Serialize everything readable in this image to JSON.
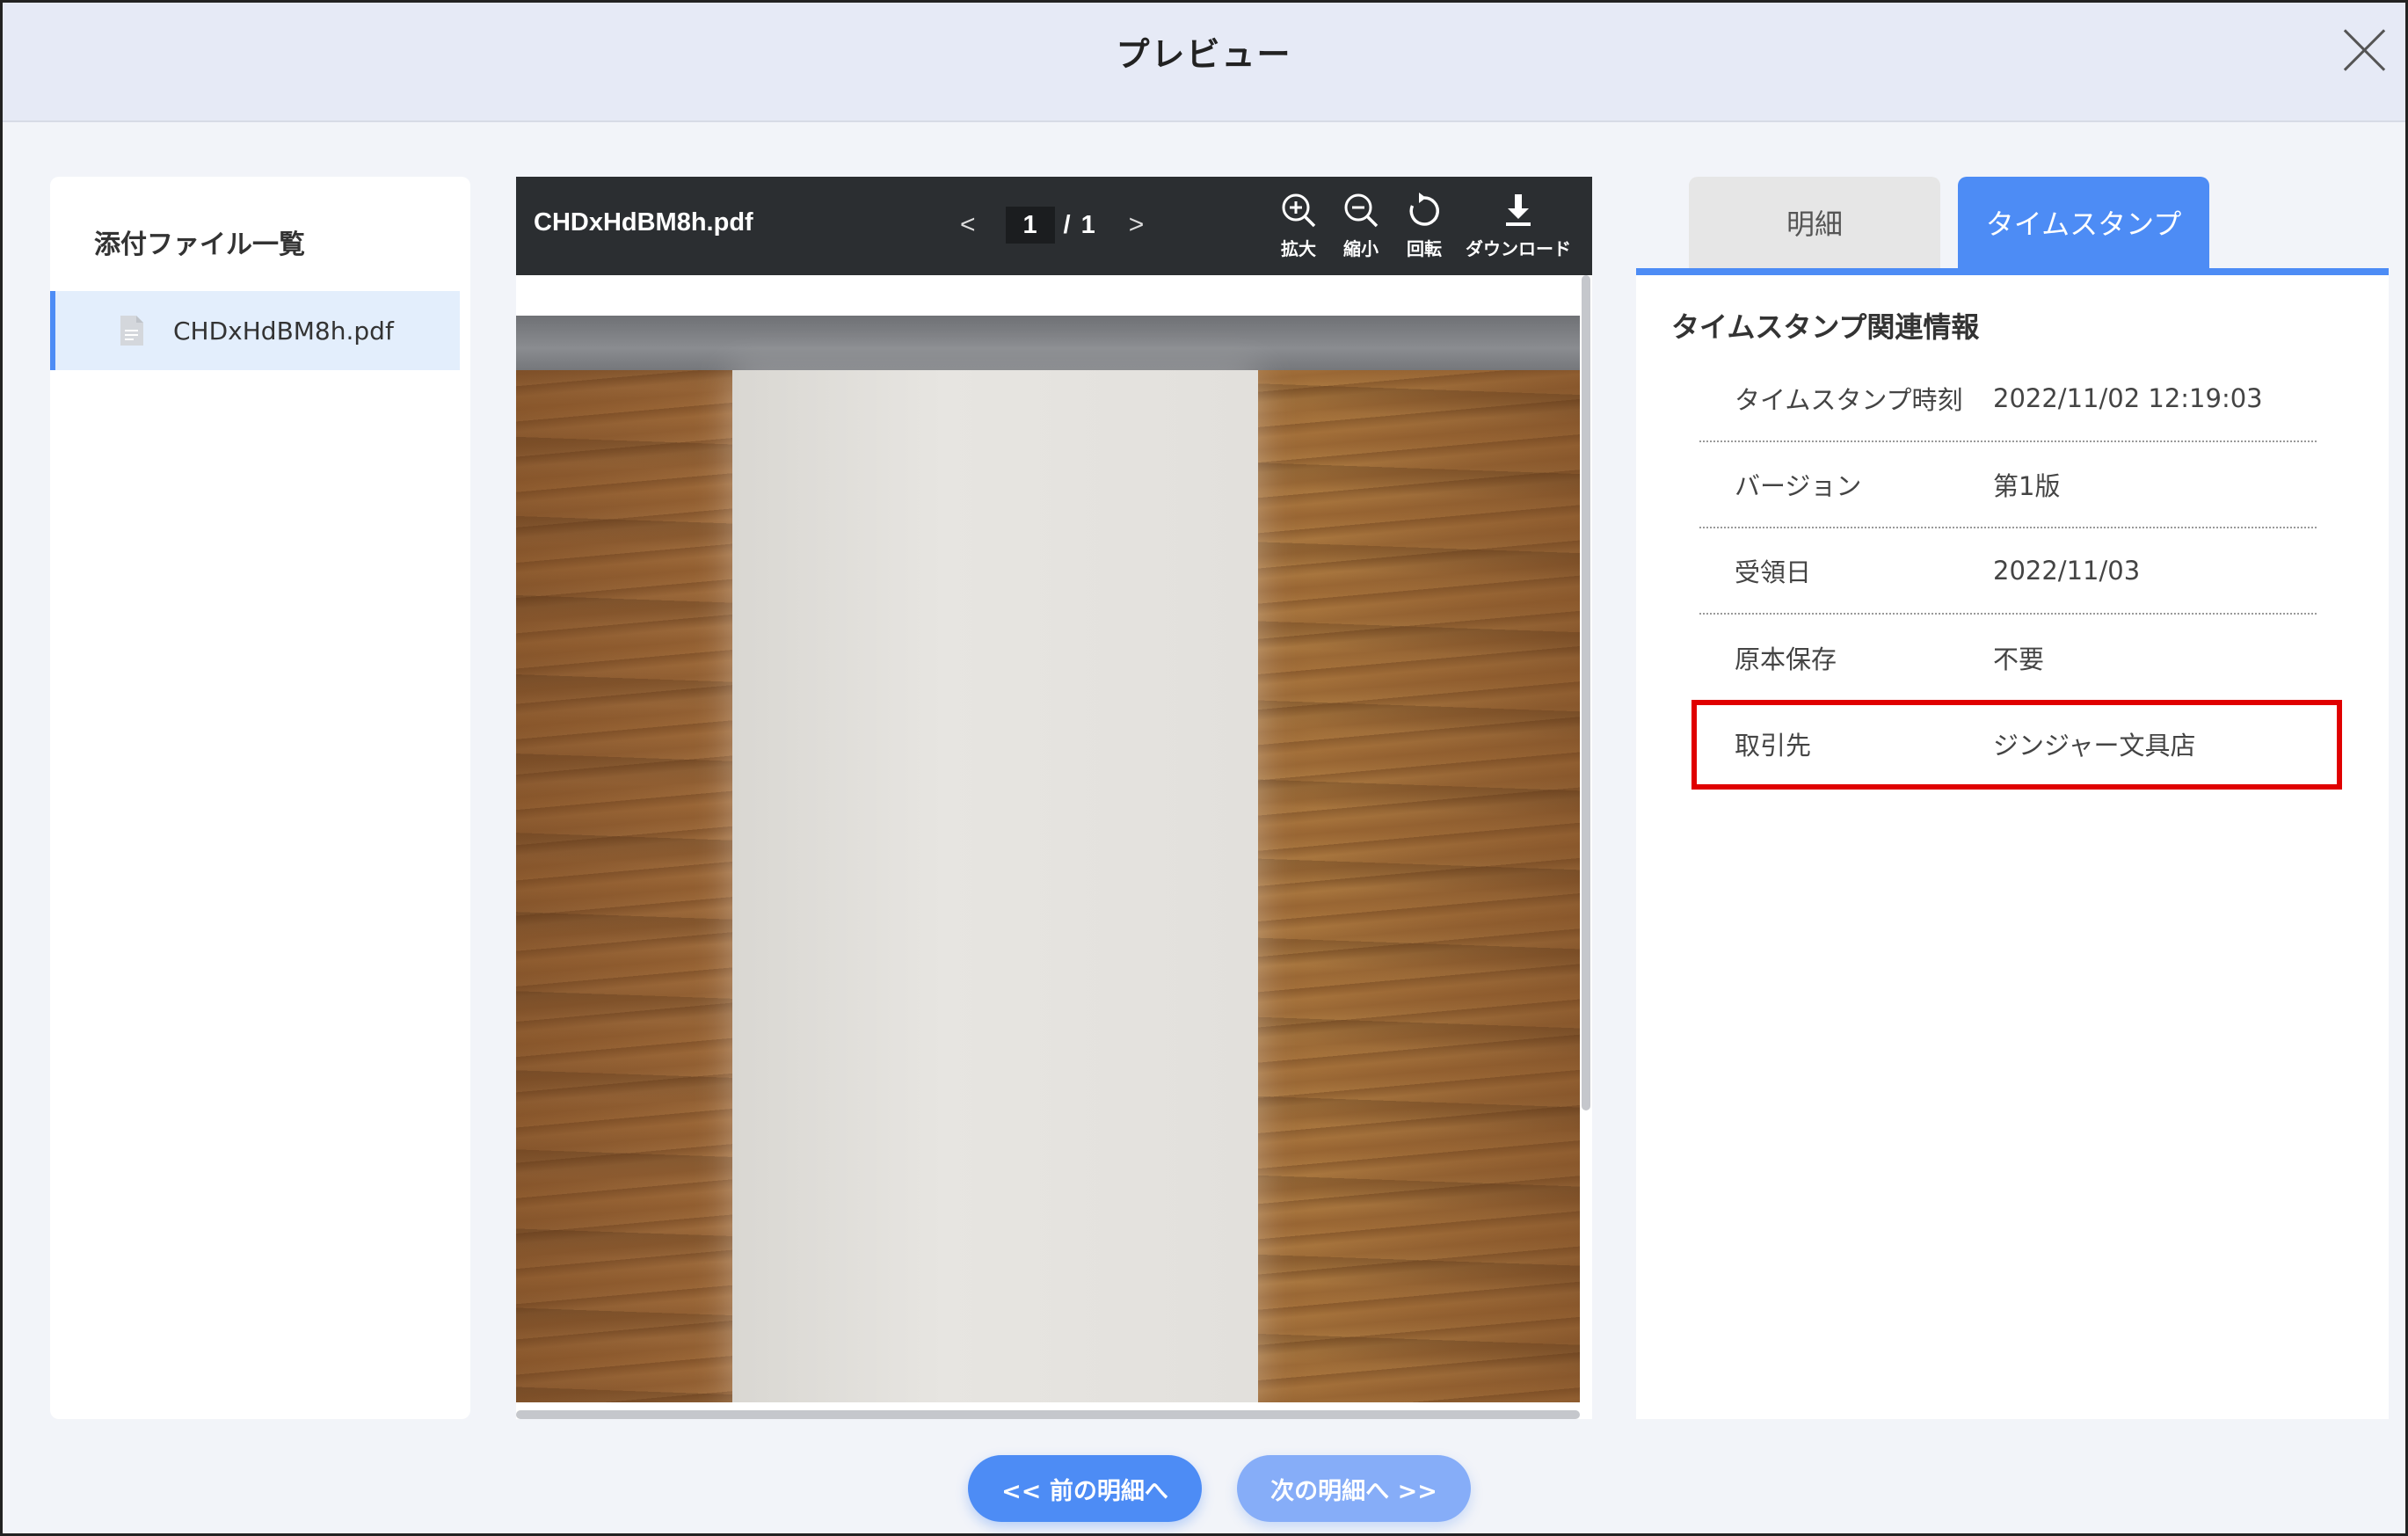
{
  "header": {
    "title": "プレビュー"
  },
  "left": {
    "title": "添付ファイル一覧",
    "files": [
      {
        "name": "CHDxHdBM8h.pdf"
      }
    ]
  },
  "viewer": {
    "filename": "CHDxHdBM8h.pdf",
    "prev": "<",
    "next": ">",
    "page": "1",
    "separator": "/",
    "total": "1",
    "tools": {
      "zoom_in": "拡大",
      "zoom_out": "縮小",
      "rotate": "回転",
      "download": "ダウンロード"
    }
  },
  "tabs": {
    "detail": "明細",
    "timestamp": "タイムスタンプ"
  },
  "info": {
    "title": "タイムスタンプ関連情報",
    "rows": [
      {
        "label": "タイムスタンプ時刻",
        "value": "2022/11/02 12:19:03"
      },
      {
        "label": "バージョン",
        "value": "第1版"
      },
      {
        "label": "受領日",
        "value": "2022/11/03"
      },
      {
        "label": "原本保存",
        "value": "不要"
      },
      {
        "label": "取引先",
        "value": "ジンジャー文具店"
      }
    ]
  },
  "buttons": {
    "prev": "<< 前の明細へ",
    "next": "次の明細へ >>"
  },
  "colors": {
    "accent": "#4d8cf5",
    "highlight": "#e00000",
    "toolbar": "#2b2e31"
  }
}
